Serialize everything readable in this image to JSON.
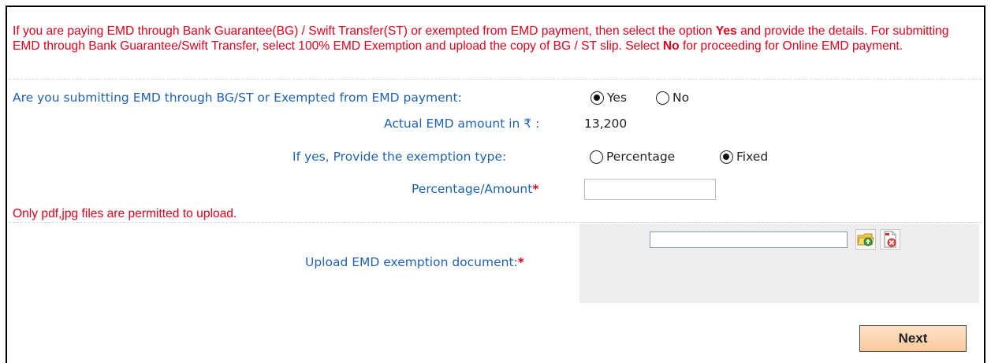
{
  "notice": {
    "part1": "If you are paying EMD through Bank Guarantee(BG) / Swift Transfer(ST) or exempted from EMD payment, then select the option ",
    "yes_word": "Yes",
    "part2": " and provide the details. For submitting EMD through Bank Guarantee/Swift Transfer, select 100% EMD Exemption and upload the copy of BG / ST slip. Select ",
    "no_word": "No",
    "part3": " for proceeding for Online EMD payment."
  },
  "form": {
    "bg_question_label": "Are you submitting EMD through BG/ST or Exempted from EMD payment:",
    "bg_options": [
      {
        "label": "Yes",
        "checked": true
      },
      {
        "label": "No",
        "checked": false
      }
    ],
    "actual_amount_label": "Actual EMD amount in ₹ :",
    "actual_amount_value": "13,200",
    "exemption_type_label": "If yes, Provide the exemption type:",
    "exemption_options": [
      {
        "label": "Percentage",
        "checked": false
      },
      {
        "label": "Fixed",
        "checked": true
      }
    ],
    "percentage_amount_label": "Percentage/Amount",
    "percentage_amount_value": "",
    "required_marker": "*",
    "upload_note": "Only pdf,jpg files are permitted to upload.",
    "upload_label": "Upload EMD exemption document:",
    "upload_file_value": "",
    "upload_icon": "folder-upload-icon",
    "remove_icon": "remove-document-icon"
  },
  "actions": {
    "next_label": "Next"
  },
  "colors": {
    "notice_red": "#e3001b",
    "label_blue": "#1f62b5",
    "button_fill": "#f9c99b"
  }
}
